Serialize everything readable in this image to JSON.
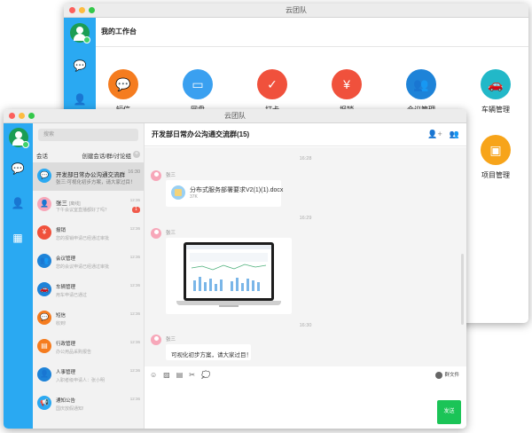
{
  "back_window": {
    "title": "云团队",
    "workbench_title": "我的工作台",
    "apps": [
      {
        "label": "短信",
        "icon": "sms-icon",
        "color": "#f57c1f",
        "glyph": "💬"
      },
      {
        "label": "网盘",
        "icon": "disk-icon",
        "color": "#3aa0f0",
        "glyph": "▭"
      },
      {
        "label": "打卡",
        "icon": "calendar-check-icon",
        "color": "#f0513c",
        "glyph": "✓"
      },
      {
        "label": "报销",
        "icon": "money-bag-icon",
        "color": "#f0513c",
        "glyph": "¥"
      },
      {
        "label": "会议管理",
        "icon": "meeting-icon",
        "color": "#1e83d8",
        "glyph": "👥"
      },
      {
        "label": "车辆管理",
        "icon": "car-icon",
        "color": "#22b8c8",
        "glyph": "🚗"
      },
      {
        "label": "项目管理",
        "icon": "box-icon",
        "color": "#f7a41a",
        "glyph": "▣"
      }
    ]
  },
  "front_window": {
    "title": "云团队",
    "search_placeholder": "搜索",
    "section_label": "会话",
    "new_conv_label": "创建会话/群/讨论组",
    "plus": "+",
    "conversations": [
      {
        "name": "开发部日常办公沟通交流群",
        "preview": "张三:可视化初步方案，请大家过目！",
        "time": "16:30",
        "color": "#2aa9f2",
        "glyph": "💬",
        "active": true
      },
      {
        "name": "张三",
        "name_extra": "[离线]",
        "preview": "下午会议室直播都好了吗？",
        "time": "12:36",
        "color": "#f7a7b9",
        "glyph": "👤",
        "badge": "1"
      },
      {
        "name": "报销",
        "preview": "您的报销申请已经通过审批",
        "time": "12:36",
        "color": "#f0513c",
        "glyph": "¥"
      },
      {
        "name": "会议管理",
        "preview": "您的会议申请已经通过审批",
        "time": "12:36",
        "color": "#1e83d8",
        "glyph": "👥"
      },
      {
        "name": "车辆管理",
        "preview": "用车申请已通过",
        "time": "12:36",
        "color": "#1e83d8",
        "glyph": "🚗"
      },
      {
        "name": "短信",
        "preview": "收到!",
        "time": "12:36",
        "color": "#f57c1f",
        "glyph": "💬"
      },
      {
        "name": "行政管理",
        "preview": "办公用品采购报告",
        "time": "12:36",
        "color": "#f57c1f",
        "glyph": "▤"
      },
      {
        "name": "人事管理",
        "preview": "入职者级申请人：张小明",
        "time": "12:36",
        "color": "#1e83d8",
        "glyph": "👤"
      },
      {
        "name": "通知公告",
        "preview": "国庆放假通知!",
        "time": "12:36",
        "color": "#2aa9f2",
        "glyph": "📢"
      }
    ],
    "chat": {
      "title": "开发部日常办公沟通交流群(15)",
      "timestamps": [
        "16:28",
        "16:29",
        "16:30"
      ],
      "sender": "张三",
      "file_name": "分布式服务部署要求V2(1)(1).docx",
      "file_size": "37K",
      "message_text": "可视化初步方案，请大家过目！",
      "group_files": "群文件",
      "send": "发送"
    }
  }
}
